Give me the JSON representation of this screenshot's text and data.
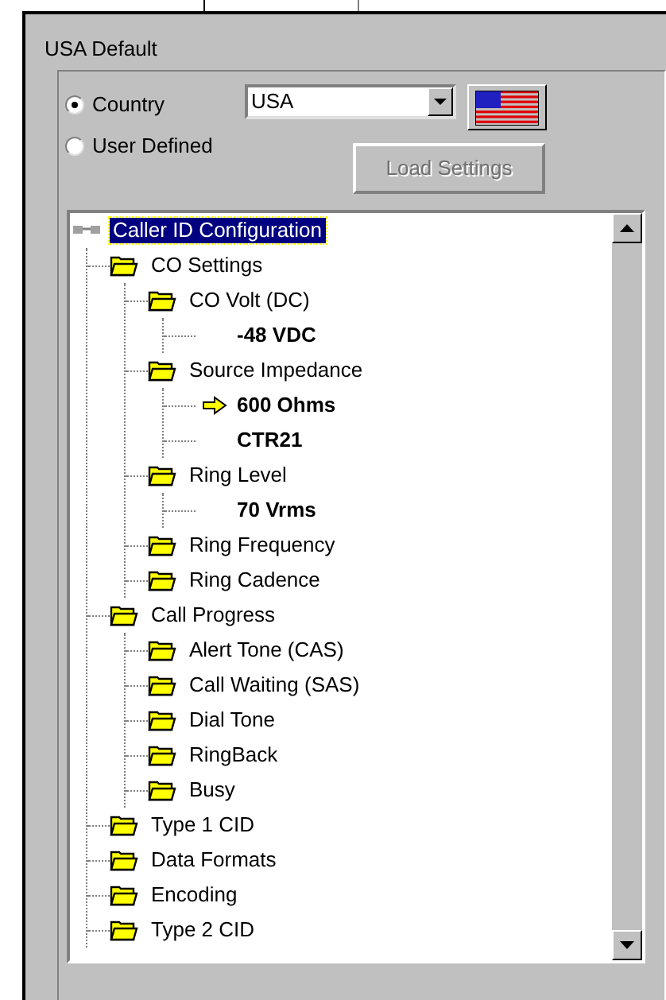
{
  "group": {
    "title": "USA Default"
  },
  "options": [
    {
      "label": "Country",
      "selected": true
    },
    {
      "label": "User Defined",
      "selected": false
    }
  ],
  "country_select": {
    "value": "USA"
  },
  "load_settings_button": {
    "label": "Load Settings",
    "disabled": true
  },
  "tree": [
    {
      "label": "Caller ID Configuration",
      "kind": "root",
      "selected": true,
      "children": [
        {
          "label": "CO Settings",
          "kind": "folder",
          "selected": false,
          "children": [
            {
              "label": "CO Volt (DC)",
              "kind": "folder",
              "selected": false,
              "children": [
                {
                  "label": "-48 VDC",
                  "kind": "value",
                  "selected": false,
                  "current": false
                }
              ]
            },
            {
              "label": "Source Impedance",
              "kind": "folder",
              "selected": false,
              "children": [
                {
                  "label": "600 Ohms",
                  "kind": "value",
                  "selected": false,
                  "current": true
                },
                {
                  "label": "CTR21",
                  "kind": "value",
                  "selected": false,
                  "current": false
                }
              ]
            },
            {
              "label": "Ring Level",
              "kind": "folder",
              "selected": false,
              "children": [
                {
                  "label": "70 Vrms",
                  "kind": "value",
                  "selected": false,
                  "current": false
                }
              ]
            },
            {
              "label": "Ring Frequency",
              "kind": "folder",
              "selected": false
            },
            {
              "label": "Ring Cadence",
              "kind": "folder",
              "selected": false
            }
          ]
        },
        {
          "label": "Call Progress",
          "kind": "folder",
          "selected": false,
          "children": [
            {
              "label": "Alert Tone (CAS)",
              "kind": "folder",
              "selected": false
            },
            {
              "label": "Call Waiting (SAS)",
              "kind": "folder",
              "selected": false
            },
            {
              "label": "Dial Tone",
              "kind": "folder",
              "selected": false
            },
            {
              "label": "RingBack",
              "kind": "folder",
              "selected": false
            },
            {
              "label": "Busy",
              "kind": "folder",
              "selected": false
            }
          ]
        },
        {
          "label": "Type 1 CID",
          "kind": "folder",
          "selected": false
        },
        {
          "label": "Data Formats",
          "kind": "folder",
          "selected": false
        },
        {
          "label": "Encoding",
          "kind": "folder",
          "selected": false
        },
        {
          "label": "Type 2 CID",
          "kind": "folder",
          "selected": false
        }
      ]
    }
  ]
}
